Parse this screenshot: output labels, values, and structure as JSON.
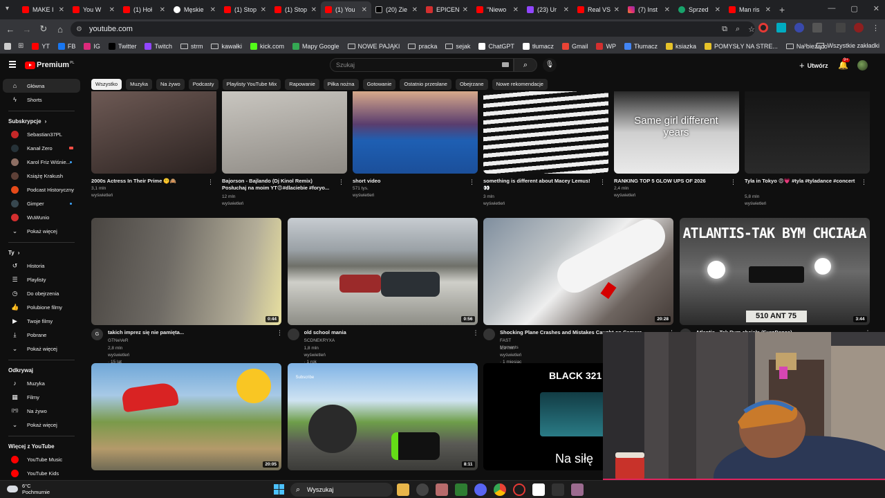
{
  "browser": {
    "tabs": [
      {
        "title": "MAKE I",
        "icon": "yt"
      },
      {
        "title": "You W",
        "icon": "yt"
      },
      {
        "title": "(1) Hoł",
        "icon": "yt"
      },
      {
        "title": "Męskie",
        "icon": "g"
      },
      {
        "title": "(1) Stop",
        "icon": "yt"
      },
      {
        "title": "(1) Stop",
        "icon": "yt"
      },
      {
        "title": "(1) You",
        "icon": "yt",
        "active": true
      },
      {
        "title": "(20) Zie",
        "icon": "x"
      },
      {
        "title": "EPICEN",
        "icon": "ep"
      },
      {
        "title": "\"Niewo",
        "icon": "yt"
      },
      {
        "title": "(23) Ur",
        "icon": "tw"
      },
      {
        "title": "Real VS",
        "icon": "yt"
      },
      {
        "title": "(7) Inst",
        "icon": "ig"
      },
      {
        "title": "Sprzed",
        "icon": "dc"
      },
      {
        "title": "Man ris",
        "icon": "yt"
      }
    ],
    "url": "youtube.com",
    "bookmarks": [
      "YT",
      "FB",
      "IG",
      "Twitter",
      "Twitch",
      "strm",
      "kawałki",
      "kick.com",
      "Mapy Google",
      "NOWE PAJĄKI",
      "pracka",
      "sejak",
      "ChatGPT",
      "tłumacz",
      "Gmail",
      "WP",
      "Tłumacz",
      "ksiazka",
      "POMYSŁY NA STRE...",
      "Na bieżąco"
    ],
    "bookmarks_other": "Wszystkie zakładki"
  },
  "header": {
    "logo_text": "Premium",
    "logo_region": "PL",
    "search_placeholder": "Szukaj",
    "create_label": "Utwórz",
    "notif_count": "9+"
  },
  "chips": [
    "Wszystko",
    "Muzyka",
    "Na żywo",
    "Podcasty",
    "Playlisty YouTube Mix",
    "Rapowanie",
    "Piłka nożna",
    "Gotowanie",
    "Ostatnio przesłane",
    "Obejrzane",
    "Nowe rekomendacje"
  ],
  "sidebar": {
    "main": [
      {
        "label": "Główna",
        "icon": "home-icon",
        "active": true
      },
      {
        "label": "Shorts",
        "icon": "shorts-icon"
      }
    ],
    "subs_header": "Subskrypcje",
    "subs": [
      {
        "label": "Sebastian37PL",
        "color": "#c62828",
        "mark": "none"
      },
      {
        "label": "Kanał Zero",
        "color": "#263238",
        "mark": "live"
      },
      {
        "label": "Karol Friz Wiśnie...",
        "color": "#8d6e63",
        "mark": "dot"
      },
      {
        "label": "Książę Krakush",
        "color": "#5d4037",
        "mark": "none"
      },
      {
        "label": "Podcast Historyczny",
        "color": "#e64a19",
        "mark": "none"
      },
      {
        "label": "Gimper",
        "color": "#37474f",
        "mark": "dot"
      },
      {
        "label": "WuWunio",
        "color": "#d32f2f",
        "mark": "none"
      }
    ],
    "subs_more": "Pokaż więcej",
    "you_header": "Ty",
    "you": [
      {
        "label": "Historia",
        "icon": "history-icon"
      },
      {
        "label": "Playlisty",
        "icon": "playlist-icon"
      },
      {
        "label": "Do obejrzenia",
        "icon": "clock-icon"
      },
      {
        "label": "Polubione filmy",
        "icon": "like-icon"
      },
      {
        "label": "Twoje filmy",
        "icon": "video-icon"
      },
      {
        "label": "Pobrane",
        "icon": "download-icon"
      },
      {
        "label": "Pokaż więcej",
        "icon": "chevron-down-icon"
      }
    ],
    "explore_header": "Odkrywaj",
    "explore": [
      {
        "label": "Muzyka",
        "icon": "music-icon"
      },
      {
        "label": "Filmy",
        "icon": "film-icon"
      },
      {
        "label": "Na żywo",
        "icon": "live-icon"
      },
      {
        "label": "Pokaż więcej",
        "icon": "chevron-down-icon"
      }
    ],
    "more_header": "Więcej z YouTube",
    "more": [
      {
        "label": "YouTube Music",
        "color": "#ff0000"
      },
      {
        "label": "YouTube Kids",
        "color": "#ff0000"
      }
    ]
  },
  "shorts": [
    {
      "title": "2000s Actress In Their Prime 🤫🙈",
      "meta": "3,1 mln wyświetleń"
    },
    {
      "title": "Bajorson - Bajlando (Dj Kinol Remix) Posłuchaj na moim YT😍#dlaciebie #foryo...",
      "meta": "12 mln wyświetleń"
    },
    {
      "title": "short video",
      "meta": "571 tys. wyświetleń"
    },
    {
      "title": "something is different about Macey Lemus! 👀",
      "meta": "3 mln wyświetleń"
    },
    {
      "title": "RANKING TOP 5 GLOW UPS OF 2026",
      "meta": "2,4 mln wyświetleń",
      "overlay": "Same girl different years"
    },
    {
      "title": "Tyla in Tokyo 😍💗 #tyla #tyladance #concert",
      "meta": "5,8 mln wyświetleń"
    }
  ],
  "videos": [
    {
      "title": "takich imprez się nie pamięta...",
      "channel": "GTNeVeR",
      "meta": "2,8 mln wyświetleń · 15 lat temu",
      "duration": "0:44",
      "av": "G"
    },
    {
      "title": "old school mania",
      "channel": "SCDNEKRYXA",
      "meta": "1,8 mln wyświetleń · 1 rok temu",
      "duration": "0:56"
    },
    {
      "title": "Shocking Plane Crashes and Mistakes Caught on Camera",
      "channel": "FAST Moments",
      "meta": "1,1 mln wyświetleń · 1 miesiąc temu",
      "duration": "20:28"
    },
    {
      "title": "Atlantis - Tak Bym chciała (EuroDance)",
      "channel": "",
      "meta": "",
      "duration": "3:44",
      "overlay": "ATLANTIS-TAK BYM CHCIAŁA",
      "plate": "510 ANT 75"
    }
  ],
  "row3": [
    {
      "duration": "20:05"
    },
    {
      "duration": "8:11",
      "overlay": "Subscribe"
    },
    {
      "overlay_top": "BLACK 321",
      "overlay_bottom": "Na siłę"
    }
  ],
  "taskbar": {
    "temp": "6°C",
    "weather": "Pochmurnie",
    "search": "Wyszukaj"
  }
}
